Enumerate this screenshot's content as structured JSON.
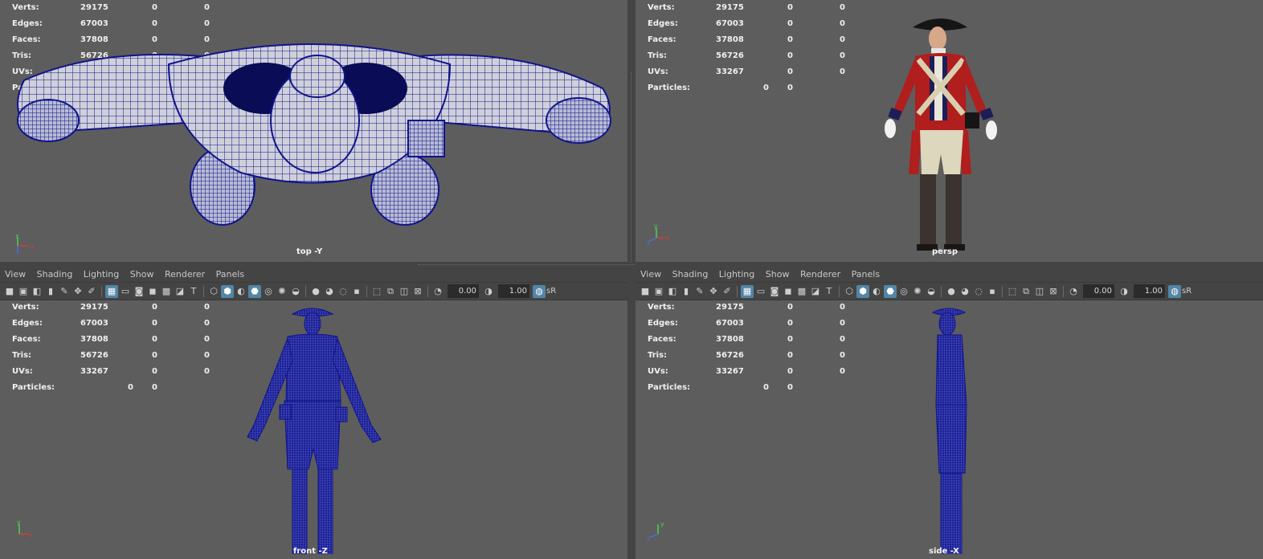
{
  "menu": [
    "View",
    "Shading",
    "Lighting",
    "Show",
    "Renderer",
    "Panels"
  ],
  "hud": {
    "rows": [
      {
        "label": "Verts:",
        "v1": "29175",
        "v2": "0",
        "v3": "0"
      },
      {
        "label": "Edges:",
        "v1": "67003",
        "v2": "0",
        "v3": "0"
      },
      {
        "label": "Faces:",
        "v1": "37808",
        "v2": "0",
        "v3": "0"
      },
      {
        "label": "Tris:",
        "v1": "56726",
        "v2": "0",
        "v3": "0"
      },
      {
        "label": "UVs:",
        "v1": "33267",
        "v2": "0",
        "v3": "0"
      },
      {
        "label": "Particles:",
        "v1": "",
        "v2": "0",
        "v3": "0"
      }
    ]
  },
  "toolbar": {
    "exposure": "0.00",
    "gamma": "1.00",
    "color_space": "sR",
    "icons": [
      "camera-icon",
      "camera-attr-icon",
      "bookmark-icon",
      "image-plane-icon",
      "grease-pencil-icon",
      "2d-pan-zoom-icon",
      "grid-icon",
      "film-gate-icon",
      "resolution-gate-icon",
      "gate-mask-icon",
      "field-chart-icon",
      "safe-action-icon",
      "safe-title-icon",
      "wireframe-icon",
      "smooth-shade-icon",
      "default-material-icon",
      "wireframe-on-shaded-icon",
      "xray-icon",
      "lights-icon",
      "shadows-icon",
      "ssao-icon",
      "motion-blur-icon",
      "anti-alias-icon",
      "dof-icon",
      "isolate-icon",
      "xray-joints-icon",
      "xray-active-icon",
      "backface-icon",
      "exposure-icon",
      "gamma-icon",
      "view-transform-icon"
    ]
  },
  "viewports": {
    "top": {
      "label": "top -Y"
    },
    "persp": {
      "label": "persp"
    },
    "front": {
      "label": "front -Z"
    },
    "side": {
      "label": "side -X"
    }
  },
  "axis": {
    "x": "x",
    "y": "y",
    "z": "z"
  },
  "colors": {
    "viewport_bg": "#5d5d5d",
    "wire": "#10148a",
    "coat_red": "#b01e1e",
    "axis_x": "#d23c3c",
    "axis_y": "#4fd04f",
    "axis_z": "#4a6ee0",
    "toggle_on": "#5285a6"
  }
}
